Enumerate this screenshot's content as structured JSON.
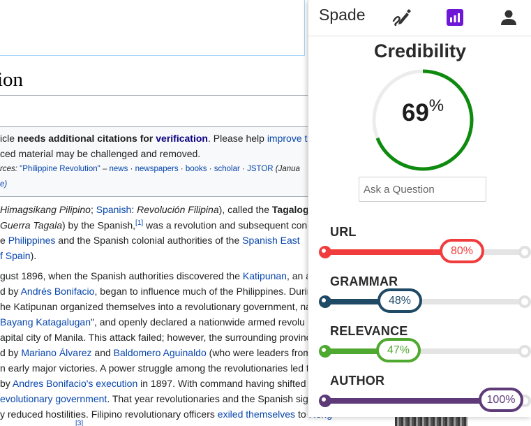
{
  "wiki": {
    "title_fragment": "ion",
    "ambox": {
      "line1": {
        "a": "icle ",
        "b": "needs additional citations for ",
        "c": "verification",
        "d": ". Please help ",
        "e": "improve t"
      },
      "line2": "ced material may be challenged and removed.",
      "line3": {
        "label": "rces: ",
        "a": "\"Philippine Revolution\"",
        "dash": " – ",
        "b": "news",
        "sep": " · ",
        "c": "newspapers",
        "d": "books",
        "e": "scholar",
        "f": "JSTOR",
        "g": " (Janua"
      },
      "line4": "e)"
    },
    "body": {
      "l1": {
        "a": "Himagsikang Pilipino",
        "b": "; ",
        "c": "Spanish",
        "d": ": ",
        "e": "Revolución Filipina",
        "f": "), called the ",
        "g": "Tagalog W"
      },
      "l2": {
        "a": "Guerra Tagala",
        "b": ") by the Spanish,",
        "sup": "[1]",
        "c": " was a revolution and subsequent con"
      },
      "l3": {
        "a": "e ",
        "b": "Philippines",
        "c": " and the Spanish colonial authorities of the ",
        "d": "Spanish East"
      },
      "l4": {
        "a": "f Spain",
        "b": ")."
      },
      "l5": {
        "a": "gust 1896, when the Spanish authorities discovered the ",
        "b": "Katipunan",
        "c": ", an a"
      },
      "l6": {
        "a": "d by ",
        "b": "Andrés Bonifacio",
        "c": ", began to influence much of the Philippines. Durin"
      },
      "l7": "he Katipunan organized themselves into a revolutionary government, na",
      "l8": {
        "a": "Bayang Katagalugan",
        "b": "\", and openly declared a nationwide armed revolu"
      },
      "l9": "apital city of Manila. This attack failed; however, the surrounding provinc",
      "l10": {
        "a": "d by ",
        "b": "Mariano Álvarez",
        "c": " and ",
        "d": "Baldomero Aguinaldo",
        "e": " (who were leaders from"
      },
      "l11": "n early major victories. A power struggle among the revolutionaries led to",
      "l12": {
        "a": "by ",
        "b": "Andres Bonifacio's execution",
        "c": " in 1897. With command having shifted"
      },
      "l13": {
        "a": "evolutionary government",
        "b": ". That year revolutionaries and the Spanish sig"
      },
      "l14": {
        "a": "y reduced hostilities. Filipino revolutionary officers ",
        "b": "exiled themselves",
        "c": " to ",
        "d": "Hong"
      },
      "l15_sup": "[3]"
    }
  },
  "spade": {
    "brand": "Spade",
    "icons": {
      "edit": "pen-edit-icon",
      "chart": "bar-chart-icon",
      "user": "user-icon"
    },
    "credibility": {
      "title": "Credibility",
      "value": "69",
      "unit": "%",
      "fraction": 0.69,
      "color": "#0e8a0e"
    },
    "ask_placeholder": "Ask a Question",
    "metrics": [
      {
        "label": "URL",
        "value": "80%",
        "fraction": 0.8,
        "color": "#f03c3c"
      },
      {
        "label": "GRAMMAR",
        "value": "48%",
        "fraction": 0.48,
        "color": "#1f4a66"
      },
      {
        "label": "RELEVANCE",
        "value": "47%",
        "fraction": 0.47,
        "color": "#4fa82f"
      },
      {
        "label": "AUTHOR",
        "value": "100%",
        "fraction": 1.0,
        "color": "#5e3a78"
      }
    ]
  }
}
